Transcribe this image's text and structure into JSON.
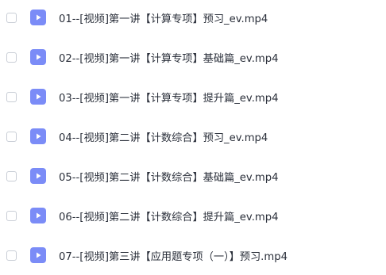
{
  "file_list": {
    "items": [
      {
        "name": "01--[视频]第一讲【计算专项】预习_ev.mp4",
        "icon": "video-file-icon"
      },
      {
        "name": "02--[视频]第一讲【计算专项】基础篇_ev.mp4",
        "icon": "video-file-icon"
      },
      {
        "name": "03--[视频]第一讲【计算专项】提升篇_ev.mp4",
        "icon": "video-file-icon"
      },
      {
        "name": "04--[视频]第二讲【计数综合】预习_ev.mp4",
        "icon": "video-file-icon"
      },
      {
        "name": "05--[视频]第二讲【计数综合】基础篇_ev.mp4",
        "icon": "video-file-icon"
      },
      {
        "name": "06--[视频]第二讲【计数综合】提升篇_ev.mp4",
        "icon": "video-file-icon"
      },
      {
        "name": "07--[视频]第三讲【应用题专项（一）】预习.mp4",
        "icon": "video-file-icon"
      }
    ]
  },
  "colors": {
    "icon_background": "#7b8cf7",
    "text": "#2a2f3a",
    "checkbox_border": "#c9ced6"
  }
}
